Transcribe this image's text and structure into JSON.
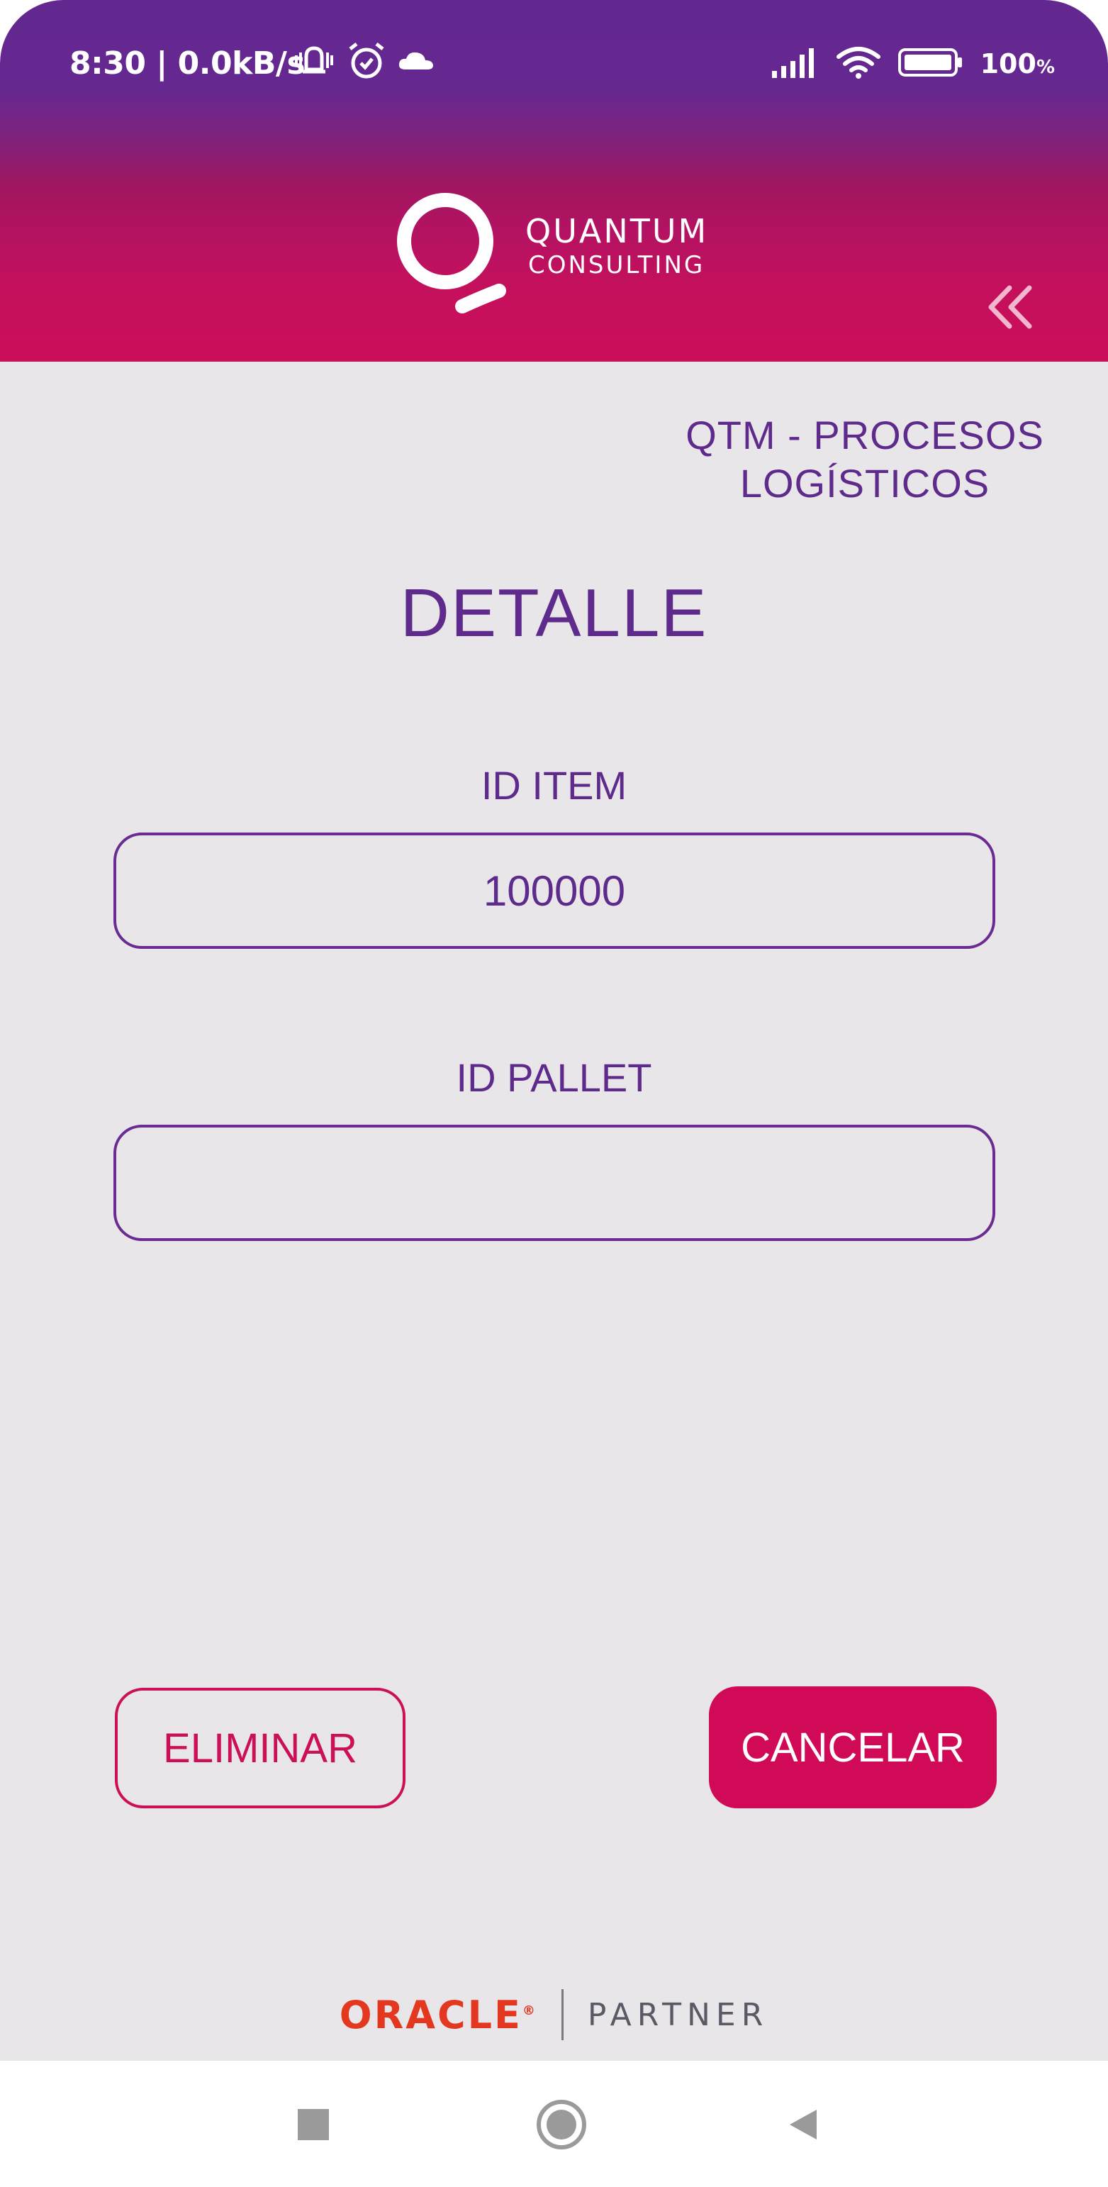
{
  "status_bar": {
    "time_speed": "8:30 | 0.0kB/s",
    "battery_value": "100",
    "battery_unit": "%",
    "icons_left": [
      "vibrate-alarm-icon",
      "alarm-clock-icon",
      "cloud-icon"
    ],
    "icons_right": [
      "signal-icon",
      "wifi-icon",
      "battery-icon"
    ]
  },
  "header": {
    "brand_line1": "QUANTUM",
    "brand_line2": "CONSULTING",
    "collapse_icon": "double-chevron-left-icon"
  },
  "content": {
    "app_title_line1": "QTM - PROCESOS",
    "app_title_line2": "LOGÍSTICOS",
    "page_title": "DETALLE",
    "item_label": "ID ITEM",
    "item_value": "100000",
    "pallet_label": "ID PALLET",
    "pallet_value": "",
    "delete_label": "ELIMINAR",
    "cancel_label": "CANCELAR"
  },
  "footer": {
    "oracle": "ORACLE",
    "registered": "®",
    "partner": "PARTNER"
  },
  "navigation": {
    "icons": [
      "recents-square-icon",
      "home-circle-icon",
      "back-triangle-icon"
    ]
  },
  "colors": {
    "purple": "#5e2a8c",
    "magenta": "#d10a58",
    "background": "#e8e6e8",
    "oracle_red": "#e3381f"
  }
}
